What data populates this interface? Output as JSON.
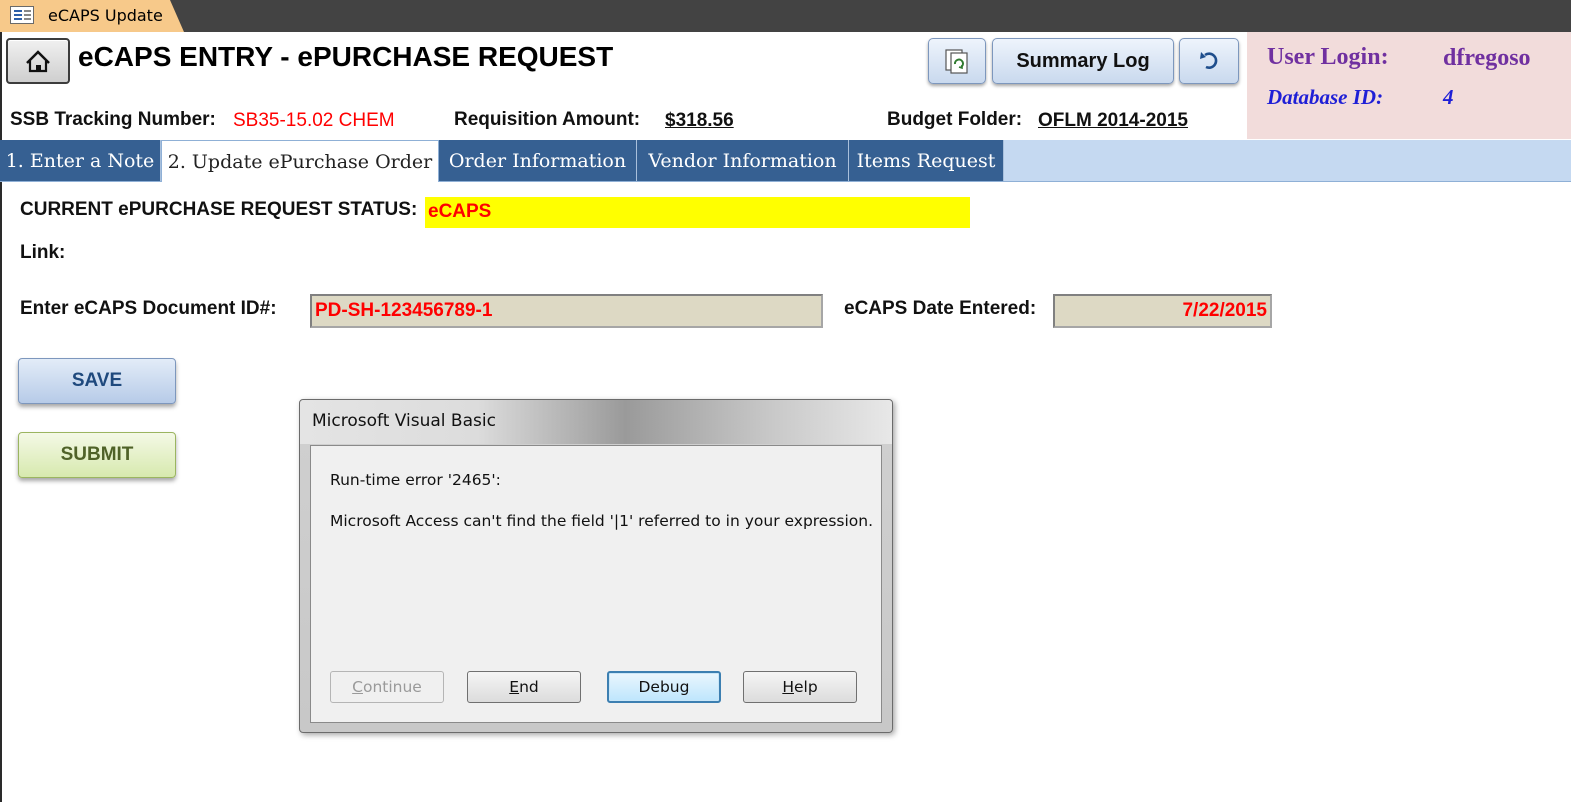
{
  "window": {
    "tab_title": "eCAPS Update"
  },
  "header": {
    "title": "eCAPS ENTRY - ePURCHASE REQUEST",
    "summary_log_label": "Summary Log",
    "icons": [
      "home-icon",
      "refresh-icon",
      "undo-icon"
    ]
  },
  "user": {
    "login_label": "User Login:",
    "login_value": "dfregoso",
    "database_label": "Database ID:",
    "database_value": "4"
  },
  "info": {
    "tracking_label": "SSB Tracking Number:",
    "tracking_value": "SB35-15.02 CHEM",
    "amount_label": "Requisition Amount:",
    "amount_value": "$318.56",
    "budget_label": "Budget Folder:",
    "budget_value": "OFLM 2014-2015"
  },
  "tabs": [
    {
      "label": "1. Enter a Note"
    },
    {
      "label": "2. Update ePurchase Order"
    },
    {
      "label": "Order Information"
    },
    {
      "label": "Vendor Information"
    },
    {
      "label": "Items Request"
    }
  ],
  "form": {
    "status_label": "CURRENT ePURCHASE REQUEST STATUS:",
    "status_value": "eCAPS",
    "link_label": "Link:",
    "doc_id_label": "Enter eCAPS Document ID#:",
    "doc_id_value": "PD-SH-123456789-1",
    "date_label": "eCAPS Date Entered:",
    "date_value": "7/22/2015",
    "save_label": "SAVE",
    "submit_label": "SUBMIT"
  },
  "dialog": {
    "title": "Microsoft Visual Basic",
    "error_code": "Run-time error '2465':",
    "message": "Microsoft Access can't find the field '|1' referred to in your expression.",
    "buttons": {
      "continue_first": "C",
      "continue_rest": "ontinue",
      "end_first": "E",
      "end_rest": "nd",
      "debug": "Debug",
      "help_first": "H",
      "help_rest": "elp"
    }
  },
  "colors": {
    "accent_tab": "#366092",
    "status_highlight": "#ffff00",
    "error_text": "#ff0000",
    "user_panel": "#f2dcdb"
  }
}
